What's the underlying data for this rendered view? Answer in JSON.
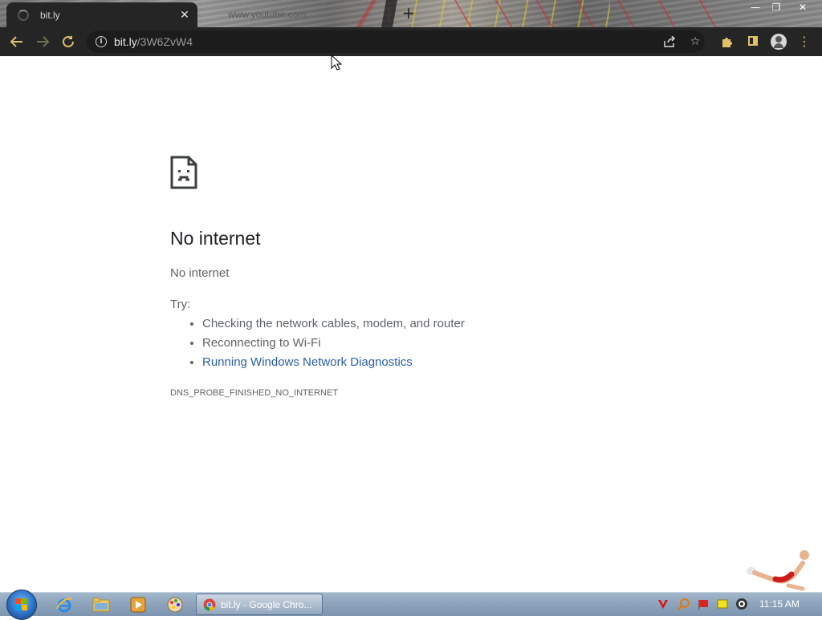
{
  "browser": {
    "tabs": [
      {
        "title": "bit.ly",
        "active": true
      },
      {
        "title": "www.youtube.com",
        "active": false
      }
    ],
    "address": {
      "host": "bit.ly",
      "path": "/3W6ZvW4"
    },
    "accent": "#e2c06a"
  },
  "error_page": {
    "title": "No internet",
    "subtitle": "No internet",
    "try_label": "Try:",
    "suggestions": [
      "Checking the network cables, modem, and router",
      "Reconnecting to Wi-Fi",
      "Running Windows Network Diagnostics"
    ],
    "error_code": "DNS_PROBE_FINISHED_NO_INTERNET",
    "link_color": "#2b5ea8"
  },
  "taskbar": {
    "task_title": "bit.ly - Google Chro...",
    "clock": "11:15 AM",
    "pinned": [
      "internet-explorer-icon",
      "file-explorer-icon",
      "media-player-icon",
      "paint-icon"
    ]
  }
}
